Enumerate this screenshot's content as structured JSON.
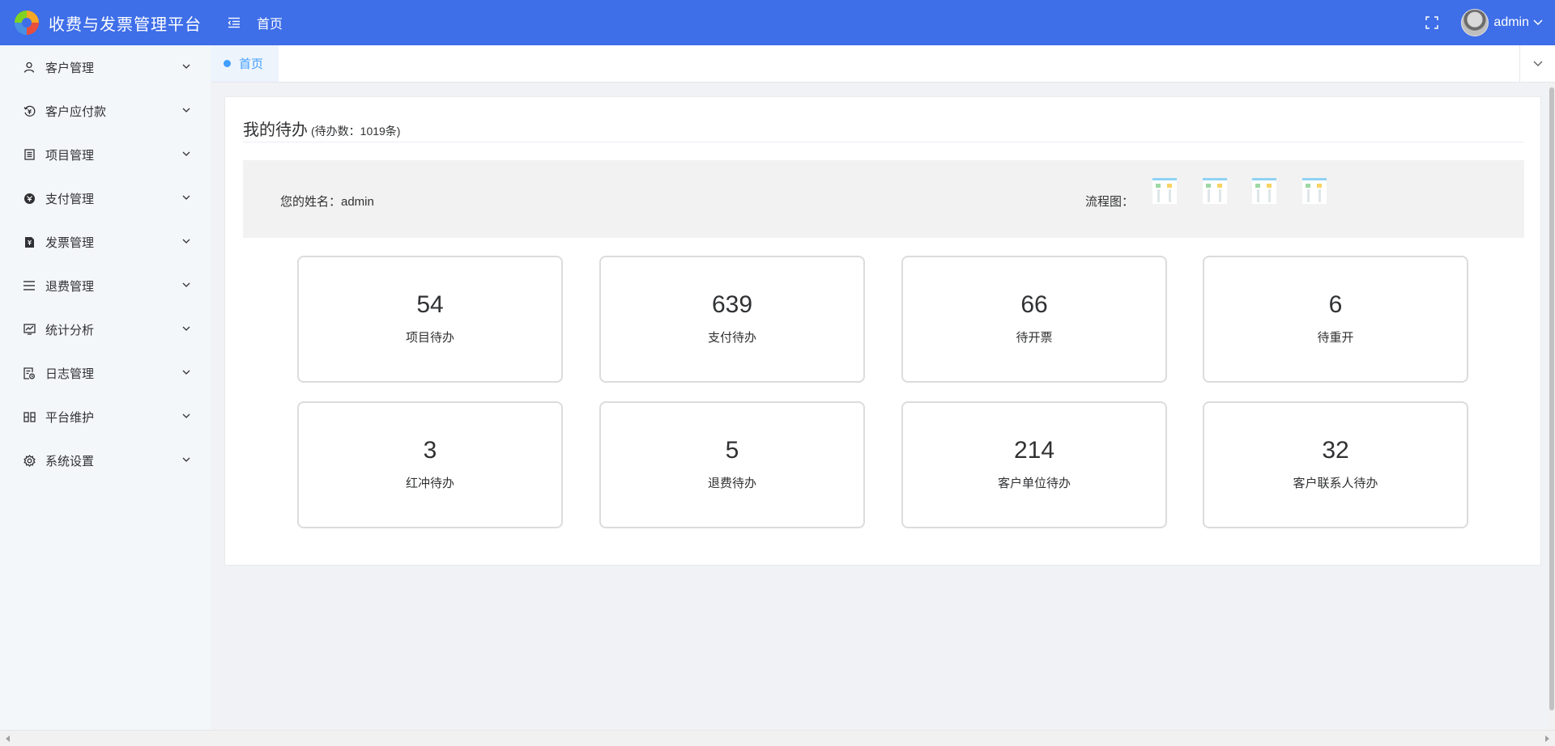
{
  "header": {
    "app_title": "收费与发票管理平台",
    "breadcrumb": "首页",
    "user_name": "admin"
  },
  "sidebar": {
    "items": [
      {
        "label": "客户管理",
        "icon": "user-icon"
      },
      {
        "label": "客户应付款",
        "icon": "receivable-icon"
      },
      {
        "label": "项目管理",
        "icon": "project-icon"
      },
      {
        "label": "支付管理",
        "icon": "payment-icon"
      },
      {
        "label": "发票管理",
        "icon": "invoice-icon"
      },
      {
        "label": "退费管理",
        "icon": "list-icon"
      },
      {
        "label": "统计分析",
        "icon": "chart-icon"
      },
      {
        "label": "日志管理",
        "icon": "log-icon"
      },
      {
        "label": "平台维护",
        "icon": "maintenance-icon"
      },
      {
        "label": "系统设置",
        "icon": "gear-icon"
      }
    ]
  },
  "tabs": {
    "active": "首页"
  },
  "todo": {
    "title": "我的待办",
    "count_text": "(待办数：1019条)",
    "name_label": "您的姓名：admin",
    "flow_label": "流程图："
  },
  "stats": [
    {
      "value": "54",
      "label": "项目待办"
    },
    {
      "value": "639",
      "label": "支付待办"
    },
    {
      "value": "66",
      "label": "待开票"
    },
    {
      "value": "6",
      "label": "待重开"
    },
    {
      "value": "3",
      "label": "红冲待办"
    },
    {
      "value": "5",
      "label": "退费待办"
    },
    {
      "value": "214",
      "label": "客户单位待办"
    },
    {
      "value": "32",
      "label": "客户联系人待办"
    }
  ],
  "colors": {
    "header_bg": "#3e6ee8",
    "accent": "#409eff",
    "sidebar_bg": "#f4f7fa"
  }
}
